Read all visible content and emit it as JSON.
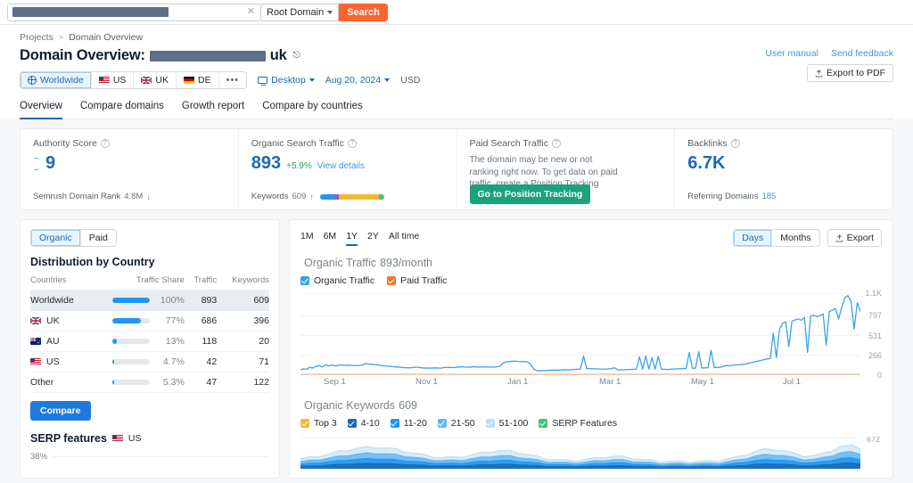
{
  "topbar": {
    "search_placeholder": "",
    "search_value_redacted": true,
    "clear_icon": "close-icon",
    "mode_label": "Root Domain",
    "search_button": "Search"
  },
  "header": {
    "breadcrumb": {
      "root": "Projects",
      "separator": ">",
      "current": "Domain Overview"
    },
    "title_prefix": "Domain Overview:",
    "domain_suffix": "uk",
    "external_link_icon": "external-link-icon",
    "user_manual": "User manual",
    "send_feedback": "Send feedback",
    "export_pdf": "Export to PDF",
    "geo": [
      {
        "label": "Worldwide",
        "icon": "globe-icon",
        "active": true
      },
      {
        "label": "US",
        "icon": "flag-us-icon",
        "active": false
      },
      {
        "label": "UK",
        "icon": "flag-uk-icon",
        "active": false
      },
      {
        "label": "DE",
        "icon": "flag-de-icon",
        "active": false
      },
      {
        "label": "•••",
        "icon": "more-icon",
        "active": false
      }
    ],
    "device": "Desktop",
    "date": "Aug 20, 2024",
    "currency": "USD"
  },
  "tabs": [
    {
      "label": "Overview",
      "active": true
    },
    {
      "label": "Compare domains",
      "active": false
    },
    {
      "label": "Growth report",
      "active": false
    },
    {
      "label": "Compare by countries",
      "active": false
    }
  ],
  "kpis": {
    "authority": {
      "title": "Authority Score",
      "value": "9",
      "footer_label": "Semrush Domain Rank",
      "footer_value": "4.8M",
      "footer_trend": "down"
    },
    "organic": {
      "title": "Organic Search Traffic",
      "value": "893",
      "delta": "+5.9%",
      "link": "View details",
      "footer_label": "Keywords",
      "footer_value": "609",
      "footer_trend": "up",
      "bar_segments": [
        {
          "color": "#2196f3",
          "pct": 22
        },
        {
          "color": "#8a5cd6",
          "pct": 8
        },
        {
          "color": "#f5b731",
          "pct": 62
        },
        {
          "color": "#3fc37f",
          "pct": 8
        }
      ]
    },
    "paid": {
      "title": "Paid Search Traffic",
      "description": "The domain may be new or not ranking right now. To get data on paid traffic, create a Position Tracking campaign.",
      "button": "Go to Position Tracking"
    },
    "backlinks": {
      "title": "Backlinks",
      "value": "6.7K",
      "footer_label": "Referring Domains",
      "footer_value": "185"
    }
  },
  "left_panel": {
    "toggle": [
      {
        "label": "Organic",
        "active": true
      },
      {
        "label": "Paid",
        "active": false
      }
    ],
    "heading": "Distribution by Country",
    "columns": [
      "Countries",
      "Traffic Share",
      "Traffic",
      "Keywords"
    ],
    "rows": [
      {
        "country": "Worldwide",
        "flag": "globe",
        "share_pct": 100,
        "share_label": "100%",
        "traffic": "893",
        "keywords": "609",
        "highlight": true
      },
      {
        "country": "UK",
        "flag": "uk",
        "share_pct": 77,
        "share_label": "77%",
        "traffic": "686",
        "keywords": "396",
        "highlight": false
      },
      {
        "country": "AU",
        "flag": "au",
        "share_pct": 13,
        "share_label": "13%",
        "traffic": "118",
        "keywords": "20",
        "highlight": false
      },
      {
        "country": "US",
        "flag": "us",
        "share_pct": 4.7,
        "share_label": "4.7%",
        "traffic": "42",
        "keywords": "71",
        "highlight": false
      },
      {
        "country": "Other",
        "flag": "none",
        "share_pct": 5.3,
        "share_label": "5.3%",
        "traffic": "47",
        "keywords": "122",
        "highlight": false
      }
    ],
    "compare_button": "Compare",
    "serp_heading": "SERP features",
    "serp_country": "US",
    "serp_axis_top": "38%"
  },
  "right_panel": {
    "ranges": [
      {
        "label": "1M",
        "active": false
      },
      {
        "label": "6M",
        "active": false
      },
      {
        "label": "1Y",
        "active": true
      },
      {
        "label": "2Y",
        "active": false
      },
      {
        "label": "All time",
        "active": false
      }
    ],
    "granularity": [
      {
        "label": "Days",
        "active": true
      },
      {
        "label": "Months",
        "active": false
      }
    ],
    "export_label": "Export",
    "traffic_title": "Organic Traffic",
    "traffic_subtitle": "893/month",
    "traffic_legend": [
      {
        "label": "Organic Traffic",
        "color": "#3aa3e8",
        "checked": true
      },
      {
        "label": "Paid Traffic",
        "color": "#f2762e",
        "checked": true
      }
    ],
    "keywords_title": "Organic Keywords",
    "keywords_count": "609",
    "keywords_legend": [
      {
        "label": "Top 3",
        "color": "#f5b731",
        "checked": true
      },
      {
        "label": "4-10",
        "color": "#1b69b6",
        "checked": true
      },
      {
        "label": "11-20",
        "color": "#2196f3",
        "checked": true
      },
      {
        "label": "21-50",
        "color": "#63b8f0",
        "checked": true
      },
      {
        "label": "51-100",
        "color": "#b9ddf7",
        "checked": true
      },
      {
        "label": "SERP Features",
        "color": "#3fc37f",
        "checked": true
      }
    ],
    "keywords_y_top": "672"
  },
  "chart_data": {
    "type": "line",
    "title": "Organic Traffic",
    "subtitle": "893/month",
    "xlabel": "",
    "ylabel": "",
    "ylim": [
      0,
      1100
    ],
    "yticks": [
      "0",
      "266",
      "531",
      "797",
      "1.1K"
    ],
    "ytick_values": [
      0,
      266,
      531,
      797,
      1100
    ],
    "xticks": [
      "Sep 1",
      "Nov 1",
      "Jan 1",
      "Mar 1",
      "May 1",
      "Jul 1"
    ],
    "grid": true,
    "legend_position": "top",
    "series": [
      {
        "name": "Organic Traffic",
        "color": "#3aa3e8",
        "values": [
          60,
          75,
          70,
          95,
          85,
          110,
          120,
          100,
          130,
          115,
          125,
          120,
          118,
          130,
          122,
          126,
          124,
          120,
          118,
          122,
          128,
          150,
          140,
          135,
          130,
          128,
          120,
          115,
          112,
          108,
          104,
          100,
          96,
          92,
          90,
          88,
          92,
          98,
          95,
          88,
          85,
          86,
          84,
          88,
          86,
          84,
          90,
          96,
          94,
          92,
          96,
          100,
          102,
          98,
          96,
          100,
          104,
          100,
          98,
          102,
          100,
          98,
          100,
          102,
          108,
          150,
          170,
          175,
          178,
          180,
          176,
          174,
          176,
          170,
          140,
          70,
          50,
          48,
          52,
          50,
          54,
          56,
          58,
          56,
          60,
          62,
          60,
          64,
          66,
          70,
          72,
          250,
          80,
          78,
          76,
          74,
          72,
          70,
          72,
          74,
          76,
          90,
          60,
          58,
          62,
          64,
          66,
          68,
          70,
          240,
          70,
          250,
          70,
          230,
          70,
          245,
          70,
          68,
          66,
          70,
          72,
          74,
          76,
          78,
          80,
          300,
          82,
          84,
          310,
          86,
          88,
          90,
          330,
          92,
          94,
          96,
          110,
          120,
          118,
          125,
          130,
          128,
          135,
          140,
          150,
          160,
          170,
          180,
          190,
          200,
          210,
          215,
          560,
          230,
          620,
          700,
          720,
          380,
          730,
          745,
          760,
          740,
          780,
          300,
          800,
          810,
          790,
          805,
          830,
          400,
          860,
          880,
          900,
          760,
          920,
          1050,
          1080,
          1000,
          620,
          980,
          860
        ]
      }
    ]
  }
}
